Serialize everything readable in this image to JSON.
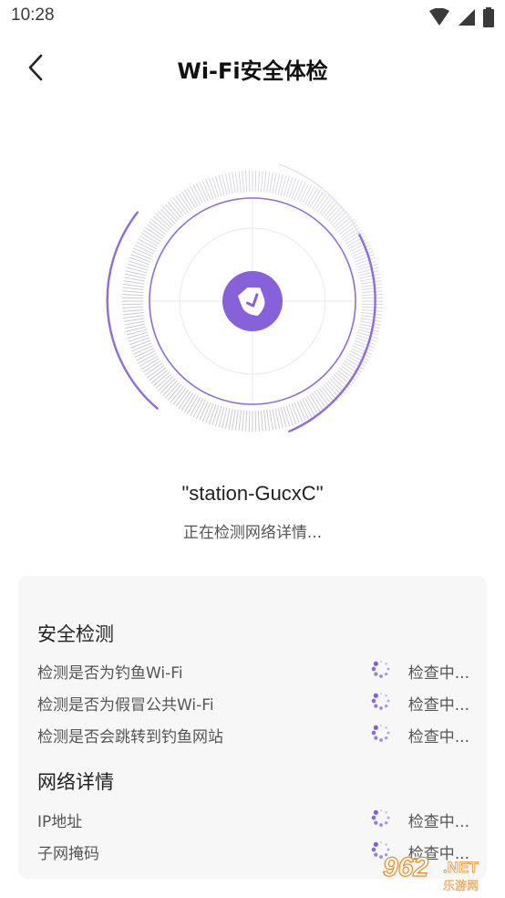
{
  "status_bar": {
    "time": "10:28"
  },
  "header": {
    "title": "Wi-Fi安全体检",
    "back_icon": "chevron-left-icon"
  },
  "scan": {
    "network_name": "\"station-GucxC\"",
    "status_text": "正在检测网络详情...",
    "accent_color": "#7b5cd6"
  },
  "security_section": {
    "title": "安全检测",
    "items": [
      {
        "label": "检测是否为钓鱼Wi-Fi",
        "status": "检查中..."
      },
      {
        "label": "检测是否为假冒公共Wi-Fi",
        "status": "检查中..."
      },
      {
        "label": "检测是否会跳转到钓鱼网站",
        "status": "检查中..."
      }
    ]
  },
  "network_section": {
    "title": "网络详情",
    "items": [
      {
        "label": "IP地址",
        "status": "检查中..."
      },
      {
        "label": "子网掩码",
        "status": "检查中..."
      }
    ]
  },
  "watermark": {
    "brand": "962",
    "domain": ".NET",
    "subtitle": "乐游网"
  }
}
